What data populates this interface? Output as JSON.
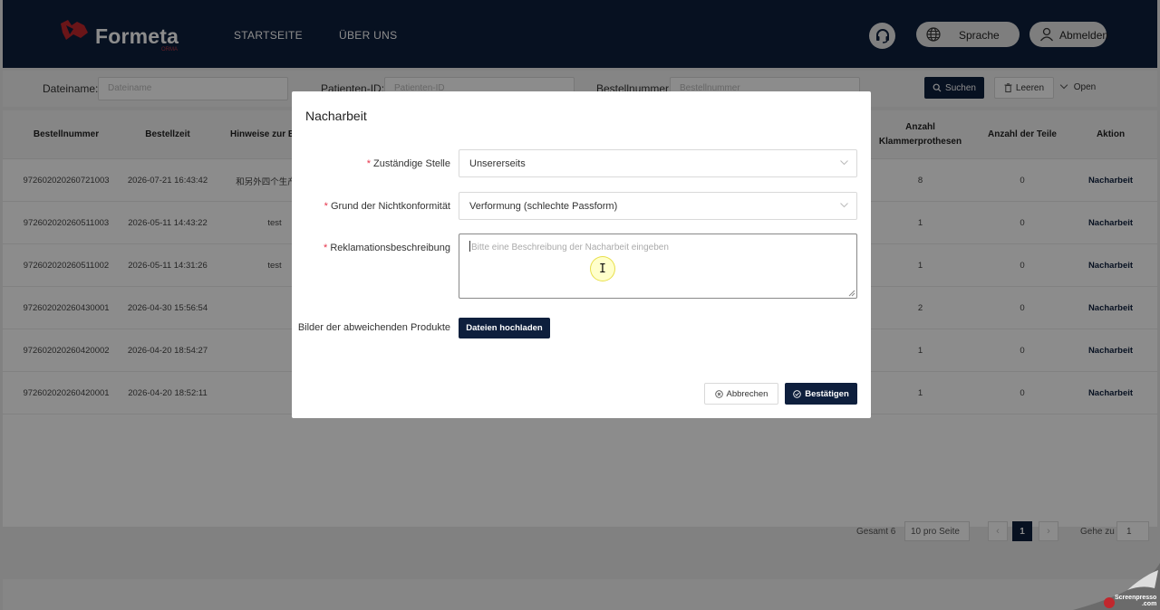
{
  "brand": {
    "name": "Formeta",
    "subtitle": "ORMA",
    "accent": "#c1272d"
  },
  "nav": {
    "home": "STARTSEITE",
    "about": "ÜBER UNS"
  },
  "header_actions": {
    "language": "Sprache",
    "logout": "Abmelden"
  },
  "filters": {
    "filename_label": "Dateiname:",
    "filename_placeholder": "Dateiname",
    "patient_label": "Patienten-ID:",
    "patient_placeholder": "Patienten-ID",
    "order_label": "Bestellnummer:",
    "order_placeholder": "Bestellnummer",
    "search": "Suchen",
    "clear": "Leeren",
    "open": "Open"
  },
  "table": {
    "columns": [
      "Bestellnummer",
      "Bestellzeit",
      "Hinweise zur Be",
      "Anzahl Klammerprothesen",
      "Anzahl der Teile",
      "Aktion"
    ],
    "rows": [
      {
        "order": "972602020260721003",
        "time": "2026-07-21 16:43:42",
        "note": "和另外四个生产订单",
        "clasp": "8",
        "parts": "0",
        "action": "Nacharbeit"
      },
      {
        "order": "972602020260511003",
        "time": "2026-05-11 14:43:22",
        "note": "test",
        "clasp": "1",
        "parts": "0",
        "action": "Nacharbeit"
      },
      {
        "order": "972602020260511002",
        "time": "2026-05-11 14:31:26",
        "note": "test",
        "clasp": "1",
        "parts": "0",
        "action": "Nacharbeit"
      },
      {
        "order": "972602020260430001",
        "time": "2026-04-30 15:56:54",
        "note": "",
        "clasp": "2",
        "parts": "0",
        "action": "Nacharbeit"
      },
      {
        "order": "972602020260420002",
        "time": "2026-04-20 18:54:27",
        "note": "",
        "clasp": "1",
        "parts": "0",
        "action": "Nacharbeit"
      },
      {
        "order": "972602020260420001",
        "time": "2026-04-20 18:52:11",
        "note": "",
        "clasp": "1",
        "parts": "0",
        "action": "Nacharbeit"
      }
    ]
  },
  "pagination": {
    "total": "Gesamt 6",
    "page_size": "10 pro Seite",
    "current": "1",
    "goto_label": "Gehe zu",
    "goto_value": "1"
  },
  "modal": {
    "title": "Nacharbeit",
    "responsible_label": "Zuständige Stelle",
    "responsible_value": "Unsererseits",
    "reason_label": "Grund der Nichtkonformität",
    "reason_value": "Verformung (schlechte Passform)",
    "description_label": "Reklamationsbeschreibung",
    "description_placeholder": "Bitte eine Beschreibung der Nacharbeit eingeben",
    "images_label": "Bilder der abweichenden Produkte",
    "upload": "Dateien hochladen",
    "cancel": "Abbrechen",
    "confirm": "Bestätigen"
  },
  "watermark": {
    "line1": "Screenpresso",
    "line2": ".com"
  }
}
